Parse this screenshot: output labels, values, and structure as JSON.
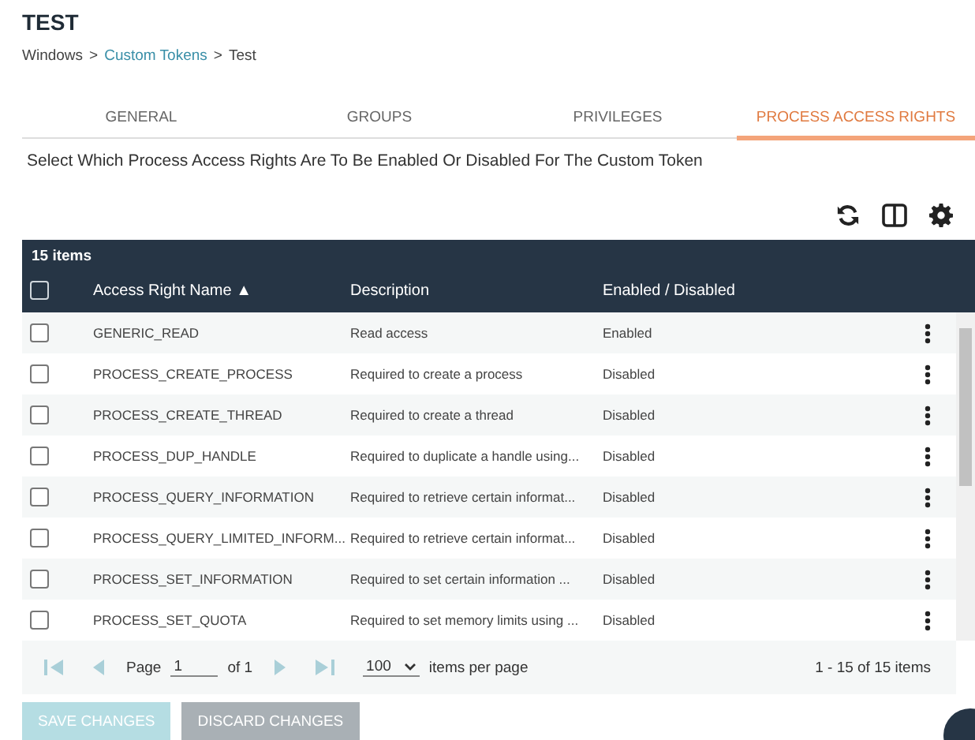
{
  "title": "TEST",
  "breadcrumb": [
    {
      "label": "Windows",
      "link": false
    },
    {
      "label": ">",
      "link": false
    },
    {
      "label": "Custom Tokens",
      "link": true
    },
    {
      "label": ">",
      "link": false
    },
    {
      "label": "Test",
      "link": false
    }
  ],
  "tabs": [
    {
      "label": "GENERAL",
      "selected": false
    },
    {
      "label": "GROUPS",
      "selected": false
    },
    {
      "label": "PRIVILEGES",
      "selected": false
    },
    {
      "label": "PROCESS ACCESS RIGHTS",
      "selected": true
    }
  ],
  "instruction": "Select Which Process Access Rights Are To Be Enabled Or Disabled For The Custom Token",
  "table": {
    "count": "15 items",
    "columns": [
      "Access Right Name ▲",
      "Description",
      "Enabled / Disabled"
    ],
    "header_checked": false,
    "rows": [
      {
        "name": "GENERIC_READ",
        "description": "Read access",
        "status": "Enabled",
        "checked": false
      },
      {
        "name": "PROCESS_CREATE_PROCESS",
        "description": "Required to create a process",
        "status": "Disabled",
        "checked": false
      },
      {
        "name": "PROCESS_CREATE_THREAD",
        "description": "Required to create a thread",
        "status": "Disabled",
        "checked": false
      },
      {
        "name": "PROCESS_DUP_HANDLE",
        "description": "Required to duplicate a handle using...",
        "status": "Disabled",
        "checked": false
      },
      {
        "name": "PROCESS_QUERY_INFORMATION",
        "description": "Required to retrieve certain informat...",
        "status": "Disabled",
        "checked": false
      },
      {
        "name": "PROCESS_QUERY_LIMITED_INFORM...",
        "description": "Required to retrieve certain informat...",
        "status": "Disabled",
        "checked": false
      },
      {
        "name": "PROCESS_SET_INFORMATION",
        "description": "Required to set certain information ...",
        "status": "Disabled",
        "checked": false
      },
      {
        "name": "PROCESS_SET_QUOTA",
        "description": "Required to set memory limits using ...",
        "status": "Disabled",
        "checked": false
      }
    ]
  },
  "pager": {
    "page_label": "Page",
    "page": "1",
    "of": "of 1",
    "page_size": "100",
    "per_page": "items per page",
    "summary": "1 - 15 of 15 items"
  },
  "buttons": [
    {
      "label": "SAVE CHANGES",
      "kind": "primary",
      "disabled": true
    },
    {
      "label": "DISCARD CHANGES",
      "kind": "secondary",
      "disabled": true
    }
  ]
}
